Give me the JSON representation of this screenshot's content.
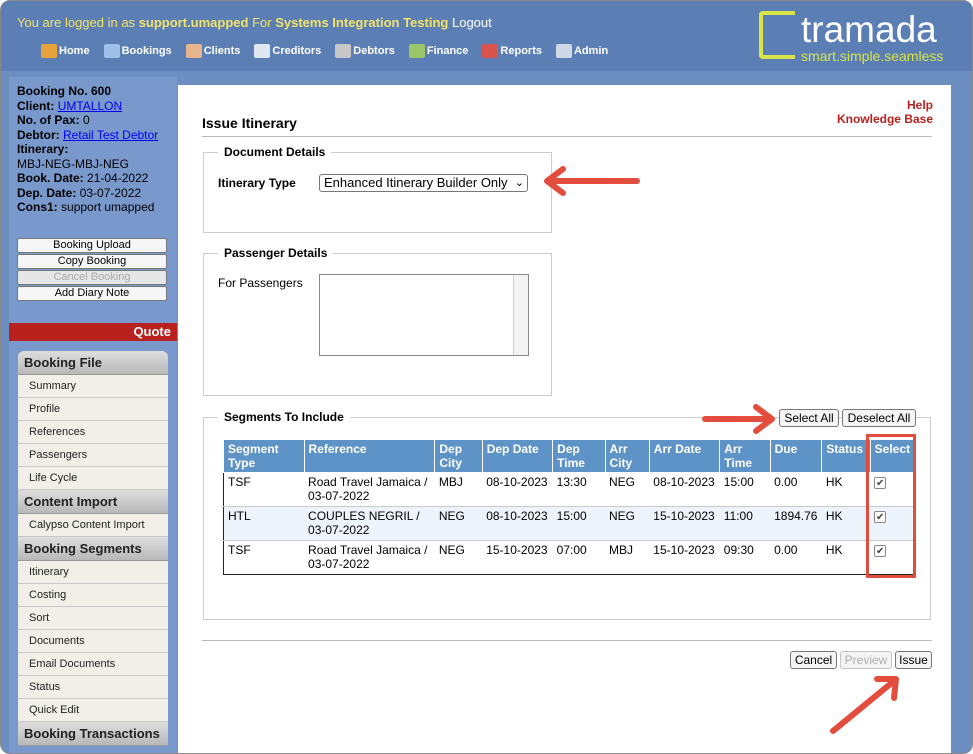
{
  "header": {
    "login_prefix": "You are logged in as",
    "user": "support.umapped",
    "for_word": "For",
    "company": "Systems Integration Testing",
    "logout": "Logout",
    "nav": [
      {
        "label": "Home",
        "icon": "home-icon",
        "color": "#e8a33c"
      },
      {
        "label": "Bookings",
        "icon": "bookings-icon",
        "color": "#9fc0e8"
      },
      {
        "label": "Clients",
        "icon": "clients-icon",
        "color": "#e6b58c"
      },
      {
        "label": "Creditors",
        "icon": "creditors-icon",
        "color": "#dfe8f2"
      },
      {
        "label": "Debtors",
        "icon": "debtors-icon",
        "color": "#c8c8c8"
      },
      {
        "label": "Finance",
        "icon": "finance-icon",
        "color": "#9ac66a"
      },
      {
        "label": "Reports",
        "icon": "reports-icon",
        "color": "#d9534f"
      },
      {
        "label": "Admin",
        "icon": "admin-icon",
        "color": "#cfd8e6"
      }
    ],
    "logo": {
      "name": "tramada",
      "tagline": "smart.simple.seamless"
    }
  },
  "booking": {
    "number_label": "Booking No. 600",
    "client_label": "Client:",
    "client": "UMTALLON",
    "pax_label": "No. of Pax:",
    "pax": "0",
    "debtor_label": "Debtor:",
    "debtor": "Retail Test Debtor",
    "itinerary_label": "Itinerary:",
    "itinerary": "MBJ-NEG-MBJ-NEG",
    "book_date_label": "Book. Date:",
    "book_date": "21-04-2022",
    "dep_date_label": "Dep. Date:",
    "dep_date": "03-07-2022",
    "cons1_label": "Cons1:",
    "cons1": "support umapped"
  },
  "left_buttons": {
    "booking_upload": "Booking Upload",
    "copy_booking": "Copy Booking",
    "cancel_booking": "Cancel Booking",
    "add_diary_note": "Add Diary Note"
  },
  "quote_label": "Quote",
  "menu": {
    "booking_file": "Booking File",
    "booking_file_items": [
      "Summary",
      "Profile",
      "References",
      "Passengers",
      "Life Cycle"
    ],
    "content_import": "Content Import",
    "content_import_items": [
      "Calypso Content Import"
    ],
    "booking_segments": "Booking Segments",
    "booking_segments_items": [
      "Itinerary",
      "Costing",
      "Sort",
      "Documents",
      "Email Documents",
      "Status",
      "Quick Edit"
    ],
    "booking_transactions": "Booking Transactions"
  },
  "main": {
    "help": "Help",
    "knowledge_base": "Knowledge Base",
    "title": "Issue Itinerary",
    "document_details": "Document Details",
    "itinerary_type_label": "Itinerary Type",
    "itinerary_type_value": "Enhanced Itinerary Builder Only",
    "passenger_details": "Passenger Details",
    "for_passengers": "For Passengers",
    "segments_to_include": "Segments To Include",
    "select_all": "Select All",
    "deselect_all": "Deselect All",
    "cancel": "Cancel",
    "preview": "Preview",
    "issue": "Issue"
  },
  "segments": {
    "headers": [
      "Segment Type",
      "Reference",
      "Dep City",
      "Dep Date",
      "Dep Time",
      "Arr City",
      "Arr Date",
      "Arr Time",
      "Due",
      "Status",
      "Select"
    ],
    "rows": [
      {
        "type": "TSF",
        "reference": "Road Travel Jamaica / 03-07-2022",
        "dep_city": "MBJ",
        "dep_date": "08-10-2023",
        "dep_time": "13:30",
        "arr_city": "NEG",
        "arr_date": "08-10-2023",
        "arr_time": "15:00",
        "due": "0.00",
        "status": "HK",
        "selected": true
      },
      {
        "type": "HTL",
        "reference": "COUPLES NEGRIL / 03-07-2022",
        "dep_city": "NEG",
        "dep_date": "08-10-2023",
        "dep_time": "15:00",
        "arr_city": "NEG",
        "arr_date": "15-10-2023",
        "arr_time": "11:00",
        "due": "1894.76",
        "status": "HK",
        "selected": true
      },
      {
        "type": "TSF",
        "reference": "Road Travel Jamaica / 03-07-2022",
        "dep_city": "NEG",
        "dep_date": "15-10-2023",
        "dep_time": "07:00",
        "arr_city": "MBJ",
        "arr_date": "15-10-2023",
        "arr_time": "09:30",
        "due": "0.00",
        "status": "HK",
        "selected": true
      }
    ]
  },
  "annotation_color": "#e24d3d"
}
